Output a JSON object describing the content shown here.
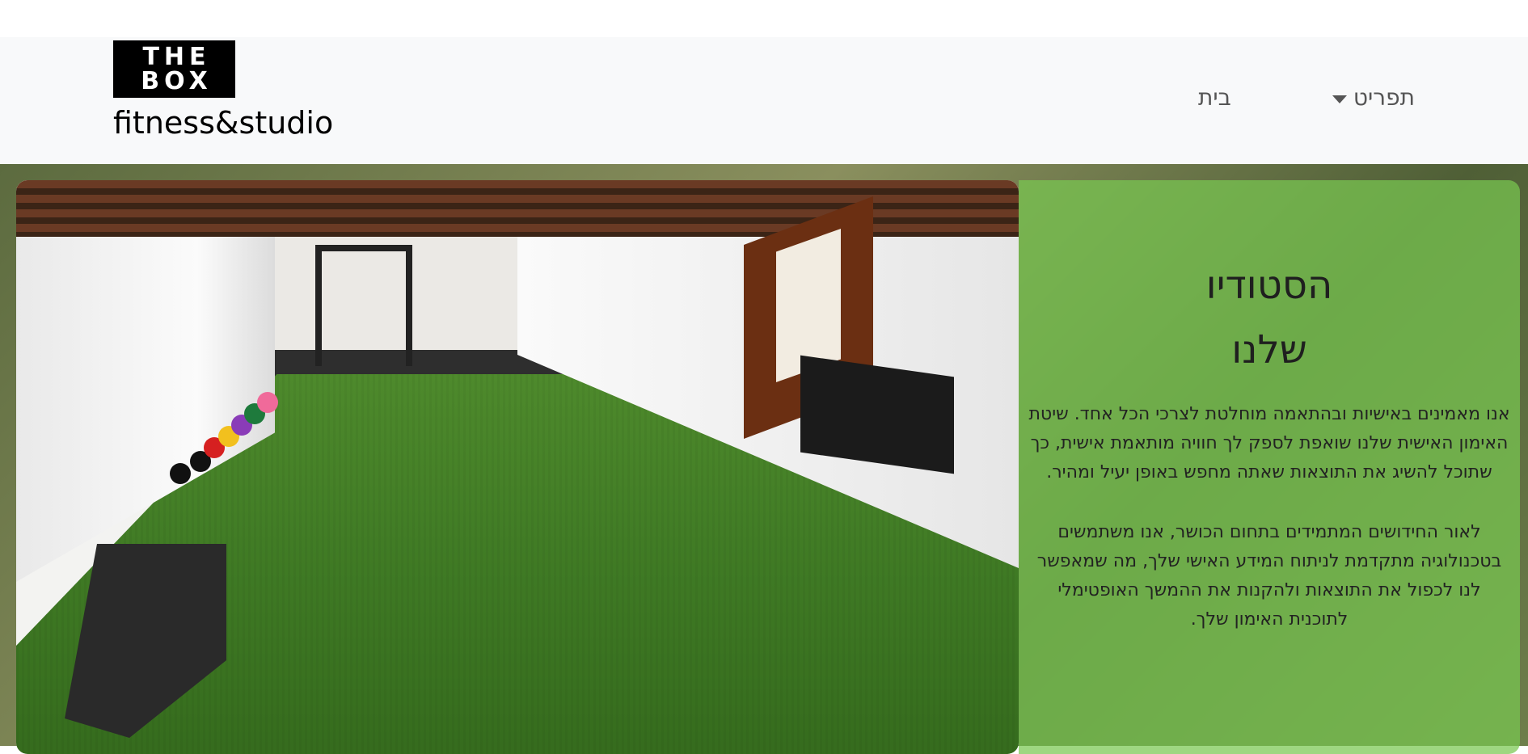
{
  "brand": {
    "logo_line1": "THE",
    "logo_line2": "BOX",
    "name": "fitness&studio"
  },
  "nav": {
    "items": [
      {
        "label": "בית"
      },
      {
        "label": "תפריט",
        "has_dropdown": true
      }
    ]
  },
  "hero": {
    "title_line1": "הסטודיו",
    "title_line2": "שלנו",
    "paragraph1": "אנו מאמינים באישיות ובהתאמה מוחלטת לצרכי הכל אחד. שיטת האימון האישית שלנו שואפת לספק לך חוויה מותאמת אישית, כך שתוכל להשיג את התוצאות שאתה מחפש באופן יעיל ומהיר.",
    "paragraph2": "לאור החידושים המתמידים בתחום הכושר, אנו משתמשים בטכנולוגיה מתקדמת לניתוח המידע האישי שלך, מה שמאפשר לנו לכפול את התוצאות ולהקנות את ההמשך האופטימלי לתוכנית האימון שלך."
  },
  "colors": {
    "navbar_bg": "#f8f9fa",
    "panel_overlay": "#78c850",
    "nav_text": "#555555"
  }
}
